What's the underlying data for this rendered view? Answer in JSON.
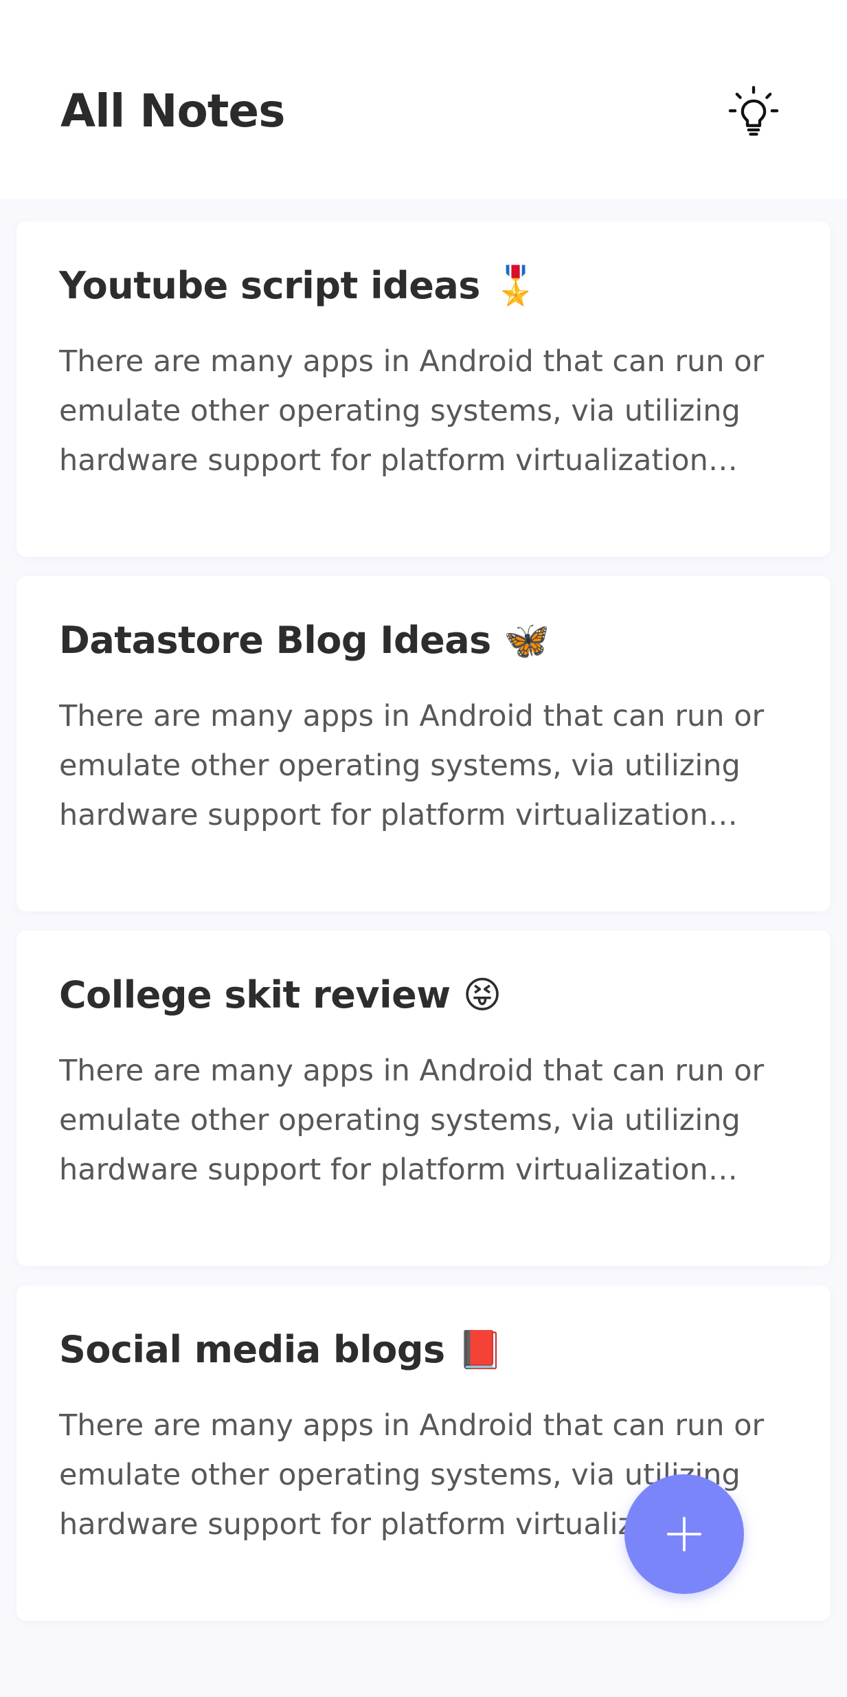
{
  "header": {
    "title": "All Notes",
    "theme_icon": "lightbulb-icon"
  },
  "notes": [
    {
      "title": "Youtube script ideas 🎖️",
      "body": "There are many apps in Android that can run or emulate other operating systems, via utilizing hardware support for platform virtualization technologies, or via terminal emulation"
    },
    {
      "title": "Datastore Blog Ideas  🦋",
      "body": "There are many apps in Android that can run or emulate other operating systems, via utilizing hardware support for platform virtualization technologies, or via terminal emulation"
    },
    {
      "title": "College skit review   😝",
      "body": "There are many apps in Android that can run or emulate other operating systems, via utilizing hardware support for platform virtualization technologies, or via terminal emulation"
    },
    {
      "title": "Social media blogs  📕",
      "body": "There are many apps in Android that can run or emulate other operating systems, via utilizing hardware support for platform virtualization technologies, or via terminal emulation"
    }
  ],
  "fab": {
    "icon": "plus-icon"
  },
  "colors": {
    "accent": "#7b85fa",
    "background": "#f8f8fd",
    "card": "#ffffff",
    "title_text": "#2d2d2d",
    "body_text": "#585858"
  }
}
